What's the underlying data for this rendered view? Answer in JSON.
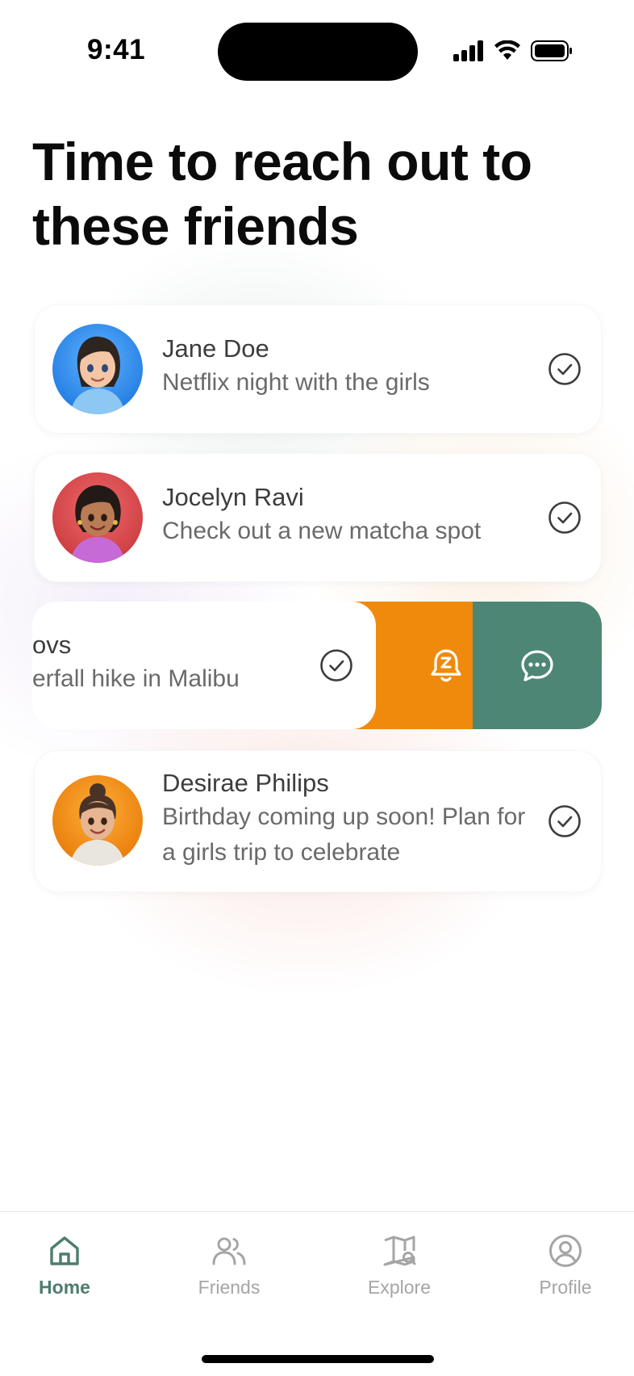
{
  "status_bar": {
    "time": "9:41"
  },
  "page": {
    "title": "Time to reach out to these friends"
  },
  "colors": {
    "accent_green": "#4e8675",
    "snooze_orange": "#ef8a0c",
    "tab_active": "#4d7d6e",
    "tab_inactive": "#a5a5a5"
  },
  "friends": [
    {
      "name": "Jane Doe",
      "note": "Netflix night with the girls",
      "avatar": "avatar-blue"
    },
    {
      "name": "Jocelyn Ravi",
      "note": "Check out a new matcha spot",
      "avatar": "avatar-red"
    },
    {
      "name": "ovs",
      "note": "erfall hike in Malibu",
      "avatar": "hidden"
    },
    {
      "name": "Desirae Philips",
      "note": "Birthday coming up soon! Plan for a girls trip to celebrate",
      "avatar": "avatar-orange"
    }
  ],
  "swipe_actions": [
    {
      "icon": "bell-snooze-icon"
    },
    {
      "icon": "chat-bubble-icon"
    }
  ],
  "tabs": [
    {
      "label": "Home",
      "icon": "home-icon",
      "active": true
    },
    {
      "label": "Friends",
      "icon": "friends-icon",
      "active": false
    },
    {
      "label": "Explore",
      "icon": "map-search-icon",
      "active": false
    },
    {
      "label": "Profile",
      "icon": "profile-icon",
      "active": false
    }
  ]
}
